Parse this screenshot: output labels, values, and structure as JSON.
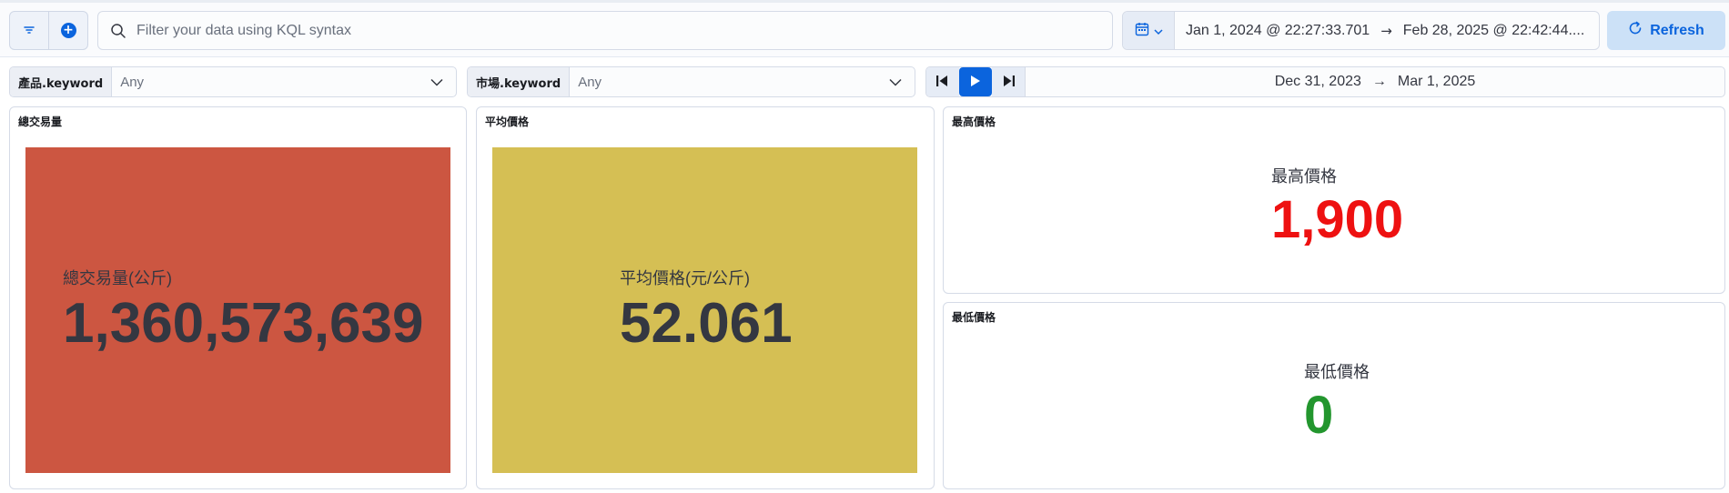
{
  "query_bar": {
    "search_placeholder": "Filter your data using KQL syntax",
    "date_start": "Jan 1, 2024 @ 22:27:33.701",
    "date_end": "Feb 28, 2025 @ 22:42:44....",
    "arrow": "→",
    "refresh_label": "Refresh"
  },
  "controls": {
    "product": {
      "label": "產品.keyword",
      "value": "Any"
    },
    "market": {
      "label": "市場.keyword",
      "value": "Any"
    }
  },
  "time_slider": {
    "range_start": "Dec 31, 2023",
    "arrow": "→",
    "range_end": "Mar 1, 2025"
  },
  "panels": {
    "total_volume": {
      "title": "總交易量",
      "label": "總交易量(公斤)",
      "value": "1,360,573,639",
      "bg_color": "#cc5641",
      "value_color": "#343741"
    },
    "avg_price": {
      "title": "平均價格",
      "label": "平均價格(元/公斤)",
      "value": "52.061",
      "bg_color": "#d5bf54",
      "value_color": "#343741"
    },
    "max_price": {
      "title": "最高價格",
      "label": "最高價格",
      "value": "1,900",
      "value_color": "#ee1111"
    },
    "min_price": {
      "title": "最低價格",
      "label": "最低價格",
      "value": "0",
      "value_color": "#23962e"
    }
  },
  "colors": {
    "accent": "#0b64dd",
    "refresh_bg": "#cce1f7"
  }
}
